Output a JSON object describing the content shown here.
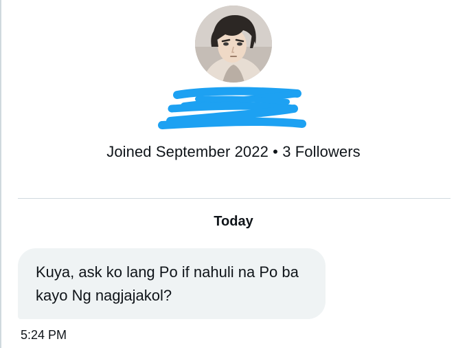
{
  "profile": {
    "joined_text": "Joined September 2022",
    "separator": "•",
    "followers_text": "3 Followers",
    "redaction_color": "#1da1f2"
  },
  "conversation": {
    "date_label": "Today",
    "messages": [
      {
        "text": "Kuya, ask ko lang Po if nahuli na Po ba kayo Ng nagjajakol?",
        "timestamp": "5:24 PM"
      }
    ]
  }
}
